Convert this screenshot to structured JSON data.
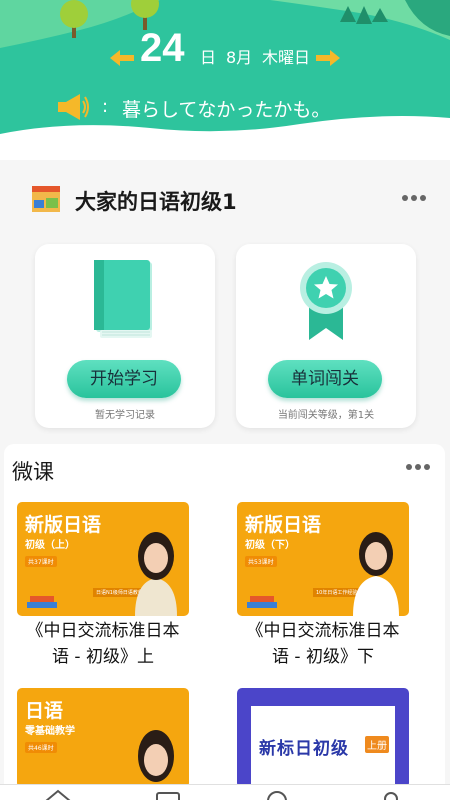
{
  "header": {
    "day": "24",
    "day_label": "日",
    "month": "8月",
    "weekday": "木曜日",
    "notice_colon": ":",
    "notice_text": "暮らしてなかったかも。",
    "prev_icon": "arrow-left-icon",
    "next_icon": "arrow-right-icon",
    "horn_icon": "megaphone-icon"
  },
  "book": {
    "title": "大家的日语初级1",
    "more_icon": "more-dots-icon"
  },
  "actions": [
    {
      "button": "开始学习",
      "sub": "暂无学习记录",
      "icon": "book-icon"
    },
    {
      "button": "单词闯关",
      "sub": "当前闯关等级，第1关",
      "icon": "medal-star-icon"
    }
  ],
  "micro": {
    "title": "微课",
    "courses": [
      {
        "thumb_title": "新版日语",
        "level": "初级（上）",
        "tag": "共37课时",
        "teacher": "日语N1级师日语教师",
        "title_line1": "《中日交流标准日本",
        "title_line2": "语 - 初级》上"
      },
      {
        "thumb_title": "新版日语",
        "level": "初级（下）",
        "tag": "共53课时",
        "teacher": "10年日语工作经验",
        "title_line1": "《中日交流标准日本",
        "title_line2": "语 - 初级》下"
      },
      {
        "thumb_title": "日语",
        "level": "零基础教学",
        "tag": "共46课时"
      },
      {
        "thumb_title": "新标日初级",
        "badge": "上册"
      }
    ]
  },
  "colors": {
    "primary_green": "#2ec49d",
    "course_orange": "#f5a60f",
    "course_purple": "#4b45c9"
  }
}
